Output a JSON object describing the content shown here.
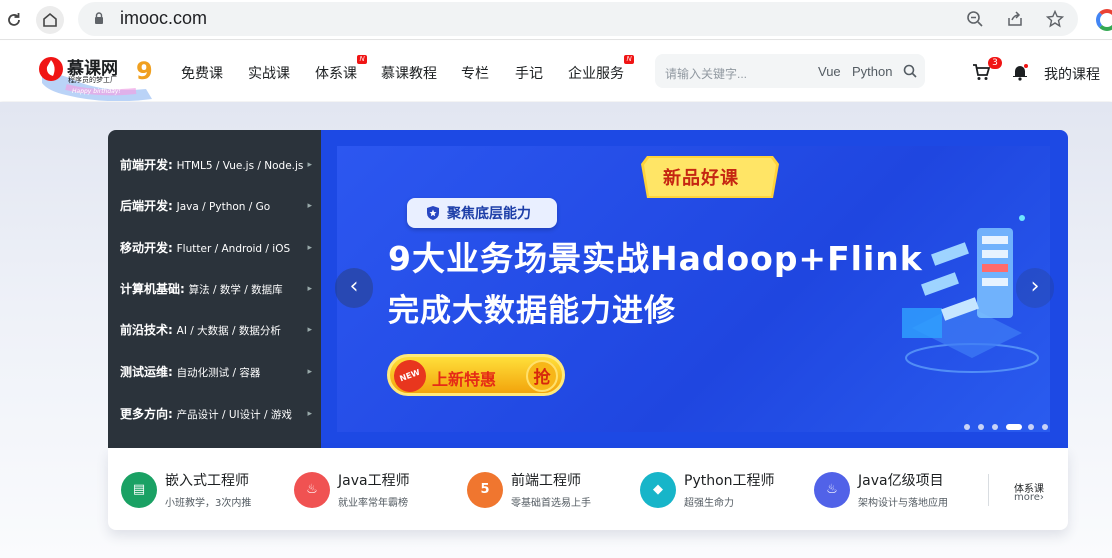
{
  "browser": {
    "url": "imooc.com",
    "icons": [
      "reload-icon",
      "home-icon",
      "lock-icon",
      "zoom-icon",
      "share-icon",
      "bookmark-star-icon",
      "profile-icon"
    ]
  },
  "header": {
    "logo_text": "慕课网",
    "logo_slogan": "程序员的梦工厂",
    "logo_ribbon": "Happy birthday!",
    "logo_number": "9",
    "nav": [
      {
        "label": "免费课",
        "badge": ""
      },
      {
        "label": "实战课",
        "badge": ""
      },
      {
        "label": "体系课",
        "badge": "N"
      },
      {
        "label": "慕课教程",
        "badge": ""
      },
      {
        "label": "专栏",
        "badge": ""
      },
      {
        "label": "手记",
        "badge": ""
      },
      {
        "label": "企业服务",
        "badge": "N"
      }
    ],
    "search": {
      "placeholder": "请输入关键字...",
      "tags": [
        "Vue",
        "Python"
      ]
    },
    "cart_count": "3",
    "my_courses": "我的课程"
  },
  "category_menu": [
    {
      "title": "前端开发:",
      "sub": "HTML5 / Vue.js / Node.js"
    },
    {
      "title": "后端开发:",
      "sub": "Java / Python / Go"
    },
    {
      "title": "移动开发:",
      "sub": "Flutter / Android / iOS"
    },
    {
      "title": "计算机基础:",
      "sub": "算法 / 数学 / 数据库"
    },
    {
      "title": "前沿技术:",
      "sub": "AI / 大数据 / 数据分析"
    },
    {
      "title": "测试运维:",
      "sub": "自动化测试 / 容器"
    },
    {
      "title": "更多方向:",
      "sub": "产品设计 / UI设计 / 游戏"
    }
  ],
  "banner": {
    "ribbon": "新品好课",
    "pill": "聚焦底层能力",
    "headline_1": "9大业务场景实战Hadoop+Flink",
    "headline_2": "完成大数据能力进修",
    "cta_new": "NEW",
    "cta_text": "上新特惠",
    "cta_grab": "抢",
    "prev": "‹",
    "next": "›",
    "dots_total": 6,
    "dots_active": 4
  },
  "paths": [
    {
      "title": "嵌入式工程师",
      "sub": "小班教学，3次内推",
      "icon": "embedded-icon",
      "color": "#1aa164"
    },
    {
      "title": "Java工程师",
      "sub": "就业率常年霸榜",
      "icon": "java-icon",
      "color": "#f05252"
    },
    {
      "title": "前端工程师",
      "sub": "零基础首选易上手",
      "icon": "html5-icon",
      "color": "#f0762f"
    },
    {
      "title": "Python工程师",
      "sub": "超强生命力",
      "icon": "python-icon",
      "color": "#17b5c9"
    },
    {
      "title": "Java亿级项目",
      "sub": "架构设计与落地应用",
      "icon": "java-icon",
      "color": "#5162e8"
    }
  ],
  "system_course": {
    "title": "体系课",
    "more": "more›"
  }
}
